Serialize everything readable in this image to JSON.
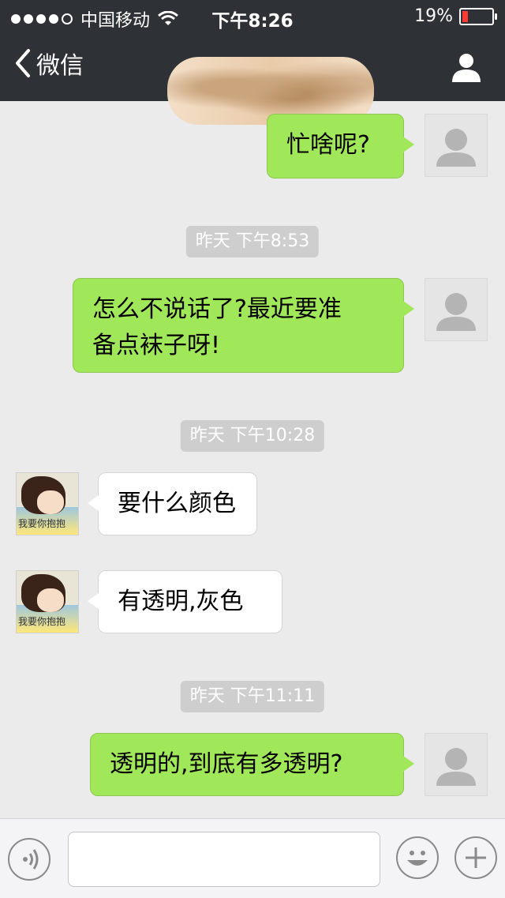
{
  "status_bar": {
    "carrier": "中国移动",
    "time": "下午8:26",
    "battery": "19%",
    "battery_level": 0.19,
    "signal_dots_filled": 4,
    "signal_dots_total": 5
  },
  "nav": {
    "back_label": "微信",
    "contact_name": ""
  },
  "messages": [
    {
      "side": "right",
      "text_lines": [
        "忙啥呢?"
      ]
    },
    {
      "type": "time",
      "text": "昨天 下午8:53"
    },
    {
      "side": "right",
      "text_lines": [
        "怎么不说话了?最近要准",
        "备点袜子呀!"
      ]
    },
    {
      "type": "time",
      "text": "昨天 下午10:28"
    },
    {
      "side": "left",
      "text_lines": [
        "要什么颜色"
      ]
    },
    {
      "side": "left",
      "text_lines": [
        "有透明,灰色"
      ]
    },
    {
      "type": "time",
      "text": "昨天 下午11:11"
    },
    {
      "side": "right",
      "text_lines": [
        "透明的,到底有多透明?"
      ]
    }
  ],
  "avatar_caption": "我要你抱抱",
  "input": {
    "value": "",
    "placeholder": ""
  },
  "colors": {
    "topbar": "#2e3135",
    "chat_bg": "#ebebeb",
    "sent_bubble": "#a0e75a",
    "received_bubble": "#ffffff",
    "timestamp_bg": "#cecece"
  },
  "icons": {
    "back": "chevron-left-icon",
    "profile": "person-icon",
    "voice": "voice-icon",
    "emoji": "smile-icon",
    "plus": "plus-icon"
  }
}
